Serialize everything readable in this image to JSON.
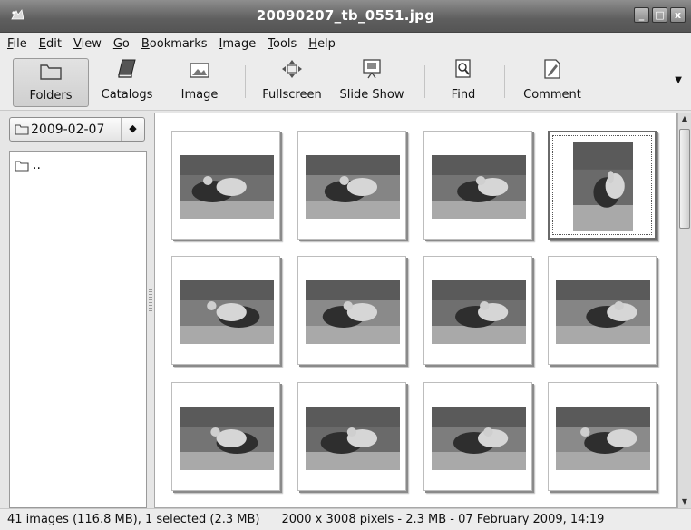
{
  "window": {
    "title": "20090207_tb_0551.jpg",
    "minimize": "_",
    "maximize": "□",
    "close": "x"
  },
  "menubar": [
    {
      "pre": "",
      "mn": "F",
      "post": "ile"
    },
    {
      "pre": "",
      "mn": "E",
      "post": "dit"
    },
    {
      "pre": "",
      "mn": "V",
      "post": "iew"
    },
    {
      "pre": "",
      "mn": "G",
      "post": "o"
    },
    {
      "pre": "",
      "mn": "B",
      "post": "ookmarks"
    },
    {
      "pre": "",
      "mn": "I",
      "post": "mage"
    },
    {
      "pre": "",
      "mn": "T",
      "post": "ools"
    },
    {
      "pre": "",
      "mn": "H",
      "post": "elp"
    }
  ],
  "toolbar": {
    "folders": "Folders",
    "catalogs": "Catalogs",
    "image": "Image",
    "fullscreen": "Fullscreen",
    "slideshow": "Slide Show",
    "find": "Find",
    "comment": "Comment",
    "more": "▼"
  },
  "folder_select": {
    "value": "2009-02-07",
    "spin": "◆"
  },
  "folder_list": [
    {
      "label": ".."
    }
  ],
  "thumbnails": [
    {
      "orientation": "landscape",
      "selected": false
    },
    {
      "orientation": "landscape",
      "selected": false
    },
    {
      "orientation": "landscape",
      "selected": false
    },
    {
      "orientation": "portrait",
      "selected": true
    },
    {
      "orientation": "landscape",
      "selected": false
    },
    {
      "orientation": "landscape",
      "selected": false
    },
    {
      "orientation": "landscape",
      "selected": false
    },
    {
      "orientation": "landscape",
      "selected": false
    },
    {
      "orientation": "landscape",
      "selected": false
    },
    {
      "orientation": "landscape",
      "selected": false
    },
    {
      "orientation": "landscape",
      "selected": false
    },
    {
      "orientation": "landscape",
      "selected": false
    }
  ],
  "statusbar": {
    "summary": "41 images (116.8 MB), 1 selected (2.3 MB)",
    "image_info": "2000 x 3008 pixels - 2.3 MB - 07 February 2009, 14:19"
  },
  "colors": {
    "titlebar": "#5e5e5e",
    "background": "#ececec",
    "grid": "#ffffff"
  }
}
